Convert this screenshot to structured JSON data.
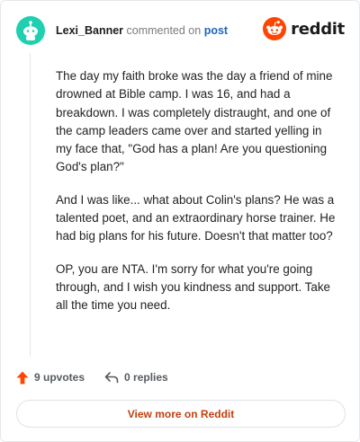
{
  "header": {
    "author": "Lexi_Banner",
    "action": "commented on",
    "post_link": "post",
    "brand": "reddit"
  },
  "comment": {
    "paragraphs": [
      "The day my faith broke was the day a friend of mine drowned at Bible camp. I was 16, and had a breakdown. I was completely distraught, and one of the camp leaders came over and started yelling in my face that, \"God has a plan! Are you questioning God's plan?\"",
      "And I was like... what about Colin's plans? He was a talented poet, and an extraordinary horse trainer. He had big plans for his future. Doesn't that matter too?",
      "OP, you are NTA. I'm sorry for what you're going through, and I wish you kindness and support. Take all the time you need."
    ]
  },
  "footer": {
    "upvotes": "9 upvotes",
    "replies": "0 replies"
  },
  "cta": {
    "label": "View more on Reddit"
  },
  "colors": {
    "avatar_bg": "#1ecfb0",
    "reddit_orange": "#ff4500",
    "link_blue": "#1c68b8",
    "cta_text": "#c2410c"
  },
  "icons": [
    "avatar-snoo-icon",
    "reddit-logo-icon",
    "upvote-arrow-icon",
    "reply-arrow-icon"
  ]
}
